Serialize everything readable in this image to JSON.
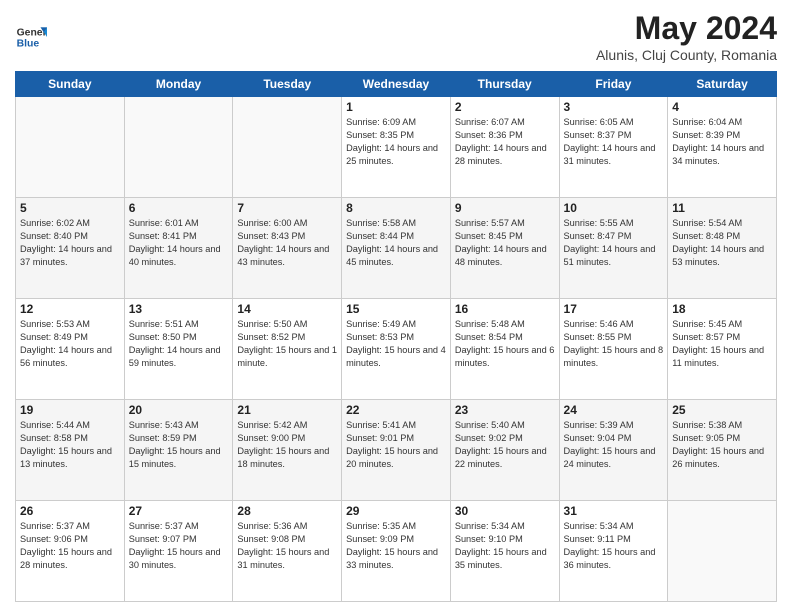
{
  "logo": {
    "line1": "General",
    "line2": "Blue"
  },
  "title": "May 2024",
  "subtitle": "Alunis, Cluj County, Romania",
  "days_of_week": [
    "Sunday",
    "Monday",
    "Tuesday",
    "Wednesday",
    "Thursday",
    "Friday",
    "Saturday"
  ],
  "weeks": [
    [
      {
        "day": "",
        "sunrise": "",
        "sunset": "",
        "daylight": ""
      },
      {
        "day": "",
        "sunrise": "",
        "sunset": "",
        "daylight": ""
      },
      {
        "day": "",
        "sunrise": "",
        "sunset": "",
        "daylight": ""
      },
      {
        "day": "1",
        "sunrise": "Sunrise: 6:09 AM",
        "sunset": "Sunset: 8:35 PM",
        "daylight": "Daylight: 14 hours and 25 minutes."
      },
      {
        "day": "2",
        "sunrise": "Sunrise: 6:07 AM",
        "sunset": "Sunset: 8:36 PM",
        "daylight": "Daylight: 14 hours and 28 minutes."
      },
      {
        "day": "3",
        "sunrise": "Sunrise: 6:05 AM",
        "sunset": "Sunset: 8:37 PM",
        "daylight": "Daylight: 14 hours and 31 minutes."
      },
      {
        "day": "4",
        "sunrise": "Sunrise: 6:04 AM",
        "sunset": "Sunset: 8:39 PM",
        "daylight": "Daylight: 14 hours and 34 minutes."
      }
    ],
    [
      {
        "day": "5",
        "sunrise": "Sunrise: 6:02 AM",
        "sunset": "Sunset: 8:40 PM",
        "daylight": "Daylight: 14 hours and 37 minutes."
      },
      {
        "day": "6",
        "sunrise": "Sunrise: 6:01 AM",
        "sunset": "Sunset: 8:41 PM",
        "daylight": "Daylight: 14 hours and 40 minutes."
      },
      {
        "day": "7",
        "sunrise": "Sunrise: 6:00 AM",
        "sunset": "Sunset: 8:43 PM",
        "daylight": "Daylight: 14 hours and 43 minutes."
      },
      {
        "day": "8",
        "sunrise": "Sunrise: 5:58 AM",
        "sunset": "Sunset: 8:44 PM",
        "daylight": "Daylight: 14 hours and 45 minutes."
      },
      {
        "day": "9",
        "sunrise": "Sunrise: 5:57 AM",
        "sunset": "Sunset: 8:45 PM",
        "daylight": "Daylight: 14 hours and 48 minutes."
      },
      {
        "day": "10",
        "sunrise": "Sunrise: 5:55 AM",
        "sunset": "Sunset: 8:47 PM",
        "daylight": "Daylight: 14 hours and 51 minutes."
      },
      {
        "day": "11",
        "sunrise": "Sunrise: 5:54 AM",
        "sunset": "Sunset: 8:48 PM",
        "daylight": "Daylight: 14 hours and 53 minutes."
      }
    ],
    [
      {
        "day": "12",
        "sunrise": "Sunrise: 5:53 AM",
        "sunset": "Sunset: 8:49 PM",
        "daylight": "Daylight: 14 hours and 56 minutes."
      },
      {
        "day": "13",
        "sunrise": "Sunrise: 5:51 AM",
        "sunset": "Sunset: 8:50 PM",
        "daylight": "Daylight: 14 hours and 59 minutes."
      },
      {
        "day": "14",
        "sunrise": "Sunrise: 5:50 AM",
        "sunset": "Sunset: 8:52 PM",
        "daylight": "Daylight: 15 hours and 1 minute."
      },
      {
        "day": "15",
        "sunrise": "Sunrise: 5:49 AM",
        "sunset": "Sunset: 8:53 PM",
        "daylight": "Daylight: 15 hours and 4 minutes."
      },
      {
        "day": "16",
        "sunrise": "Sunrise: 5:48 AM",
        "sunset": "Sunset: 8:54 PM",
        "daylight": "Daylight: 15 hours and 6 minutes."
      },
      {
        "day": "17",
        "sunrise": "Sunrise: 5:46 AM",
        "sunset": "Sunset: 8:55 PM",
        "daylight": "Daylight: 15 hours and 8 minutes."
      },
      {
        "day": "18",
        "sunrise": "Sunrise: 5:45 AM",
        "sunset": "Sunset: 8:57 PM",
        "daylight": "Daylight: 15 hours and 11 minutes."
      }
    ],
    [
      {
        "day": "19",
        "sunrise": "Sunrise: 5:44 AM",
        "sunset": "Sunset: 8:58 PM",
        "daylight": "Daylight: 15 hours and 13 minutes."
      },
      {
        "day": "20",
        "sunrise": "Sunrise: 5:43 AM",
        "sunset": "Sunset: 8:59 PM",
        "daylight": "Daylight: 15 hours and 15 minutes."
      },
      {
        "day": "21",
        "sunrise": "Sunrise: 5:42 AM",
        "sunset": "Sunset: 9:00 PM",
        "daylight": "Daylight: 15 hours and 18 minutes."
      },
      {
        "day": "22",
        "sunrise": "Sunrise: 5:41 AM",
        "sunset": "Sunset: 9:01 PM",
        "daylight": "Daylight: 15 hours and 20 minutes."
      },
      {
        "day": "23",
        "sunrise": "Sunrise: 5:40 AM",
        "sunset": "Sunset: 9:02 PM",
        "daylight": "Daylight: 15 hours and 22 minutes."
      },
      {
        "day": "24",
        "sunrise": "Sunrise: 5:39 AM",
        "sunset": "Sunset: 9:04 PM",
        "daylight": "Daylight: 15 hours and 24 minutes."
      },
      {
        "day": "25",
        "sunrise": "Sunrise: 5:38 AM",
        "sunset": "Sunset: 9:05 PM",
        "daylight": "Daylight: 15 hours and 26 minutes."
      }
    ],
    [
      {
        "day": "26",
        "sunrise": "Sunrise: 5:37 AM",
        "sunset": "Sunset: 9:06 PM",
        "daylight": "Daylight: 15 hours and 28 minutes."
      },
      {
        "day": "27",
        "sunrise": "Sunrise: 5:37 AM",
        "sunset": "Sunset: 9:07 PM",
        "daylight": "Daylight: 15 hours and 30 minutes."
      },
      {
        "day": "28",
        "sunrise": "Sunrise: 5:36 AM",
        "sunset": "Sunset: 9:08 PM",
        "daylight": "Daylight: 15 hours and 31 minutes."
      },
      {
        "day": "29",
        "sunrise": "Sunrise: 5:35 AM",
        "sunset": "Sunset: 9:09 PM",
        "daylight": "Daylight: 15 hours and 33 minutes."
      },
      {
        "day": "30",
        "sunrise": "Sunrise: 5:34 AM",
        "sunset": "Sunset: 9:10 PM",
        "daylight": "Daylight: 15 hours and 35 minutes."
      },
      {
        "day": "31",
        "sunrise": "Sunrise: 5:34 AM",
        "sunset": "Sunset: 9:11 PM",
        "daylight": "Daylight: 15 hours and 36 minutes."
      },
      {
        "day": "",
        "sunrise": "",
        "sunset": "",
        "daylight": ""
      }
    ]
  ]
}
